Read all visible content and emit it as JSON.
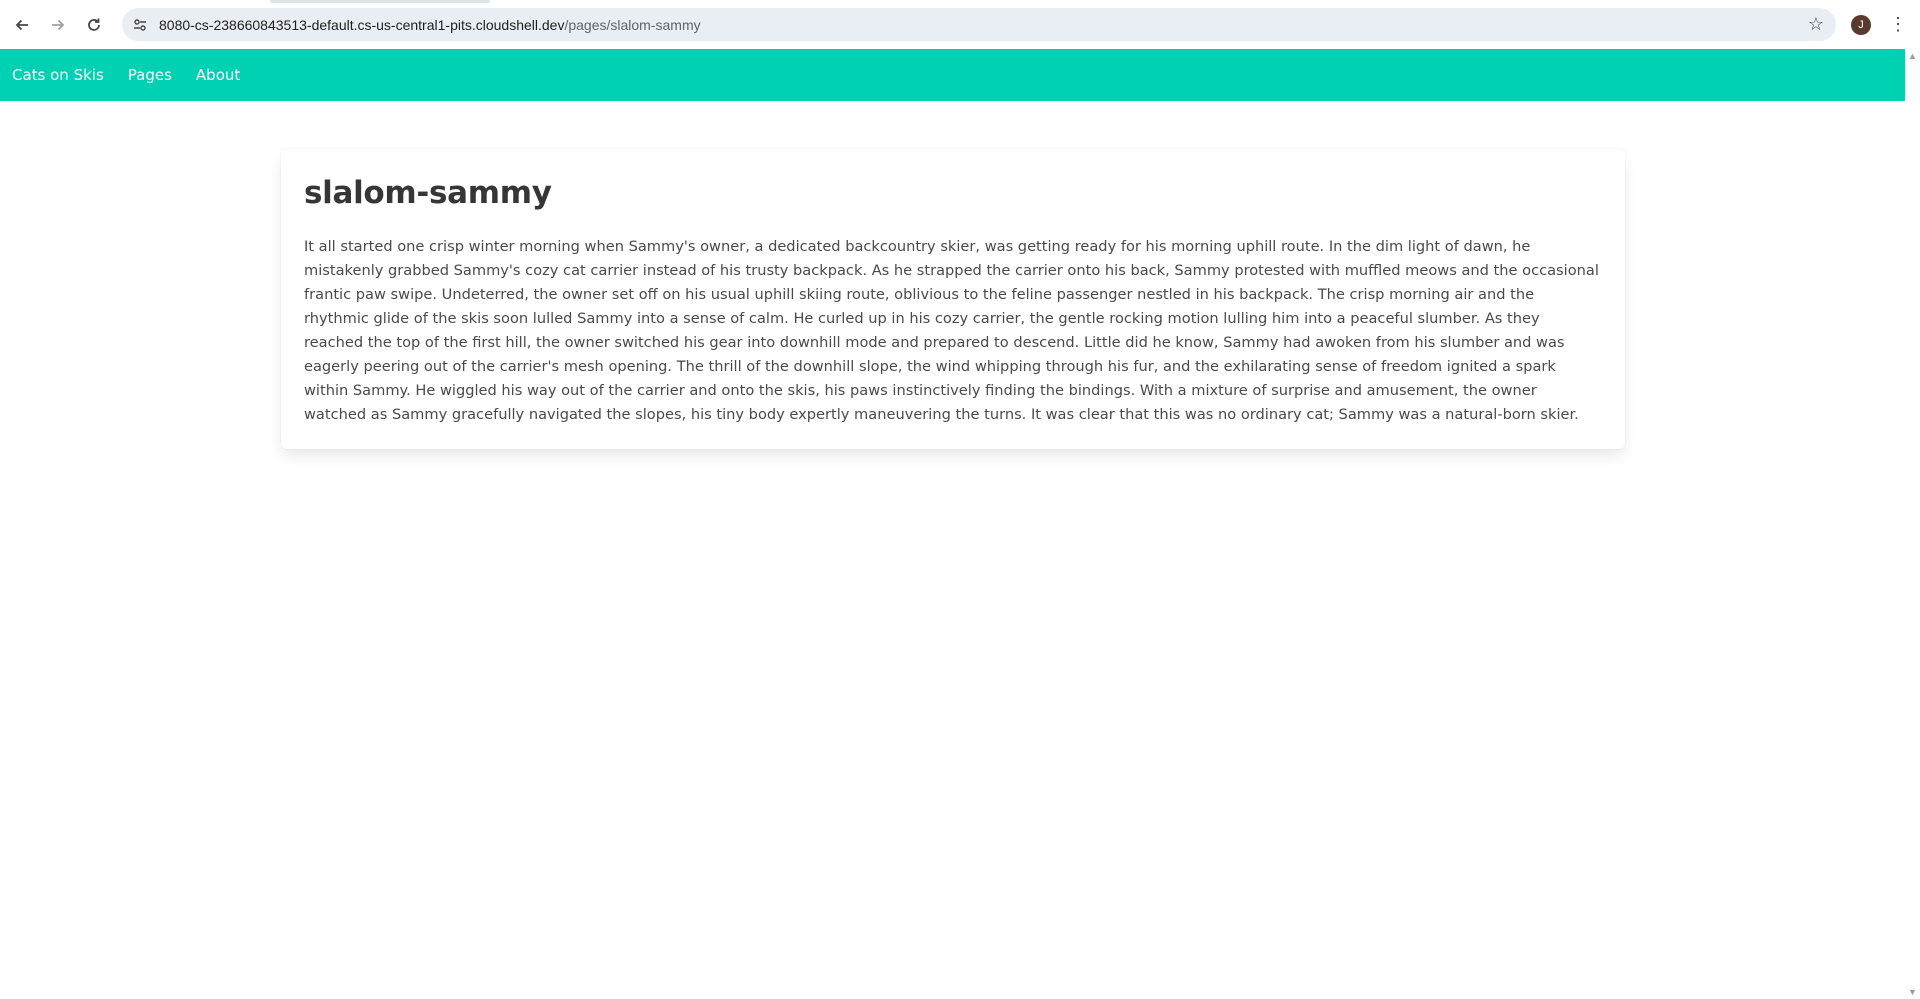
{
  "browser": {
    "url_host": "8080-cs-238660843513-default.cs-us-central1-pits.cloudshell.dev",
    "url_path": "/pages/slalom-sammy",
    "profile_initial": "J",
    "icons": [
      "back-icon",
      "forward-icon",
      "reload-icon",
      "site-info-icon",
      "bookmark-star-icon",
      "menu-dots-icon"
    ]
  },
  "navbar": {
    "brand": "Cats on Skis",
    "links": [
      "Pages",
      "About"
    ],
    "color": "#00d1b2"
  },
  "page": {
    "title": "slalom-sammy",
    "body": "It all started one crisp winter morning when Sammy's owner, a dedicated backcountry skier, was getting ready for his morning uphill route. In the dim light of dawn, he mistakenly grabbed Sammy's cozy cat carrier instead of his trusty backpack. As he strapped the carrier onto his back, Sammy protested with muffled meows and the occasional frantic paw swipe. Undeterred, the owner set off on his usual uphill skiing route, oblivious to the feline passenger nestled in his backpack. The crisp morning air and the rhythmic glide of the skis soon lulled Sammy into a sense of calm. He curled up in his cozy carrier, the gentle rocking motion lulling him into a peaceful slumber. As they reached the top of the first hill, the owner switched his gear into downhill mode and prepared to descend. Little did he know, Sammy had awoken from his slumber and was eagerly peering out of the carrier's mesh opening. The thrill of the downhill slope, the wind whipping through his fur, and the exhilarating sense of freedom ignited a spark within Sammy. He wiggled his way out of the carrier and onto the skis, his paws instinctively finding the bindings. With a mixture of surprise and amusement, the owner watched as Sammy gracefully navigated the slopes, his tiny body expertly maneuvering the turns. It was clear that this was no ordinary cat; Sammy was a natural-born skier."
  }
}
